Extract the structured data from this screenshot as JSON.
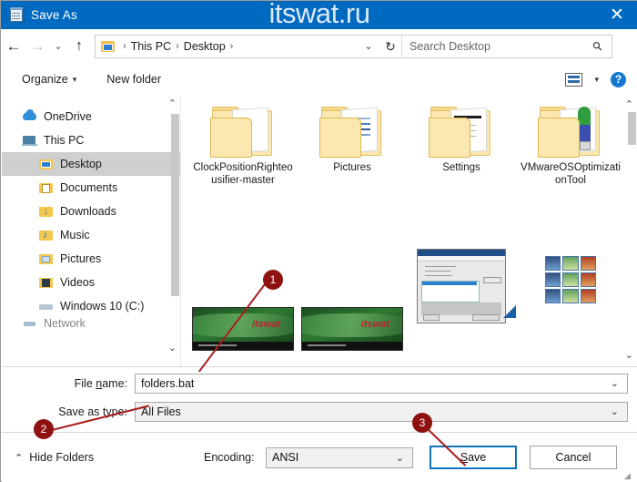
{
  "window": {
    "title": "Save As",
    "icon": "notepad-icon",
    "close_label": "✕",
    "watermark": "itswat.ru",
    "titlebar_color": "#0069c0"
  },
  "navbar": {
    "back_icon": "←",
    "forward_icon": "→",
    "recent_caret": "⌄",
    "up_icon": "↑",
    "breadcrumb": [
      "This PC",
      "Desktop"
    ],
    "breadcrumb_separator": "›",
    "trailing_caret": "⌄",
    "refresh_icon": "↻",
    "search_placeholder": "Search Desktop",
    "search_icon": "⚲"
  },
  "commandbar": {
    "organize_label": "Organize",
    "organize_caret": "▾",
    "new_folder_label": "New folder",
    "view_caret": "▾",
    "help_label": "?"
  },
  "sidebar": {
    "scroll_up": "⌃",
    "scroll_down": "⌄",
    "items": [
      {
        "label": "OneDrive",
        "icon": "cloud-icon",
        "selected": false,
        "indent": 0
      },
      {
        "label": "This PC",
        "icon": "computer-icon",
        "selected": false,
        "indent": 0
      },
      {
        "label": "Desktop",
        "icon": "desktop-folder-icon",
        "selected": true,
        "indent": 1
      },
      {
        "label": "Documents",
        "icon": "documents-folder-icon",
        "selected": false,
        "indent": 1
      },
      {
        "label": "Downloads",
        "icon": "downloads-folder-icon",
        "selected": false,
        "indent": 1
      },
      {
        "label": "Music",
        "icon": "music-folder-icon",
        "selected": false,
        "indent": 1
      },
      {
        "label": "Pictures",
        "icon": "pictures-folder-icon",
        "selected": false,
        "indent": 1
      },
      {
        "label": "Videos",
        "icon": "videos-folder-icon",
        "selected": false,
        "indent": 1
      },
      {
        "label": "Windows 10 (C:)",
        "icon": "drive-icon",
        "selected": false,
        "indent": 1
      },
      {
        "label": "Network",
        "icon": "network-icon",
        "selected": false,
        "indent": 0
      }
    ]
  },
  "content": {
    "scroll_up": "⌃",
    "scroll_down": "⌄",
    "folders": [
      {
        "name": "ClockPositionRighteousifier-master",
        "icon": "folder-icon"
      },
      {
        "name": "Pictures",
        "icon": "folder-icon"
      },
      {
        "name": "Settings",
        "icon": "folder-icon"
      },
      {
        "name": "VMwareOSOptimizationTool",
        "icon": "folder-icon"
      }
    ],
    "thumbnails": [
      {
        "type": "image-thumbnail",
        "watermark": "itswat"
      },
      {
        "type": "image-thumbnail",
        "watermark": "itswat"
      },
      {
        "type": "app-window-thumbnail"
      },
      {
        "type": "icon-grid-thumbnail"
      }
    ]
  },
  "form": {
    "filename_label_pre": "File ",
    "filename_label_accel": "n",
    "filename_label_post": "ame:",
    "filename_value": "folders.bat",
    "filename_caret": "⌄",
    "filetype_label_pre": "Save as ",
    "filetype_label_accel": "t",
    "filetype_label_post": "ype:",
    "filetype_value": "All Files",
    "filetype_caret": "⌄"
  },
  "footer": {
    "hide_folders_caret": "⌃",
    "hide_folders_label": "Hide Folders",
    "encoding_label": "Encoding:",
    "encoding_value": "ANSI",
    "encoding_caret": "⌄",
    "save_label_pre": "",
    "save_label_accel": "S",
    "save_label_post": "ave",
    "cancel_label": "Cancel",
    "resize_grip": "◢"
  },
  "annotations": {
    "marker_color": "#8e1212",
    "line_color": "#a81f1f",
    "markers": [
      {
        "number": "1",
        "points_to": "filename-field"
      },
      {
        "number": "2",
        "points_to": "filetype-field"
      },
      {
        "number": "3",
        "points_to": "save-button"
      }
    ]
  }
}
